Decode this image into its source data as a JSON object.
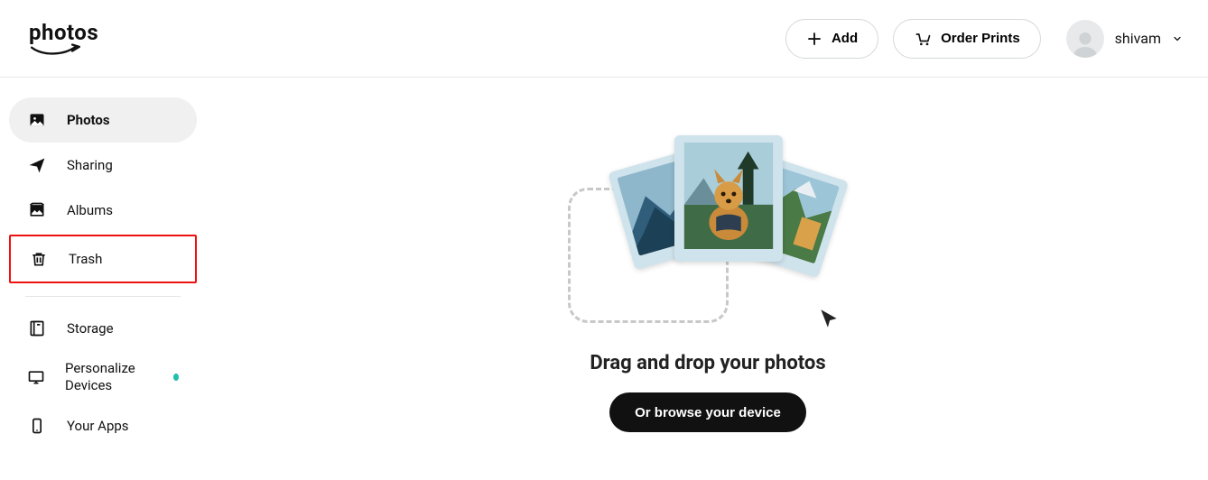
{
  "header": {
    "logo_text": "photos",
    "add_label": "Add",
    "order_prints_label": "Order Prints",
    "account_name": "shivam"
  },
  "sidebar": {
    "items": [
      {
        "label": "Photos"
      },
      {
        "label": "Sharing"
      },
      {
        "label": "Albums"
      },
      {
        "label": "Trash"
      },
      {
        "label": "Storage"
      },
      {
        "label": "Personalize Devices"
      },
      {
        "label": "Your Apps"
      }
    ]
  },
  "main": {
    "headline": "Drag and drop your photos",
    "browse_label": "Or browse your device"
  }
}
